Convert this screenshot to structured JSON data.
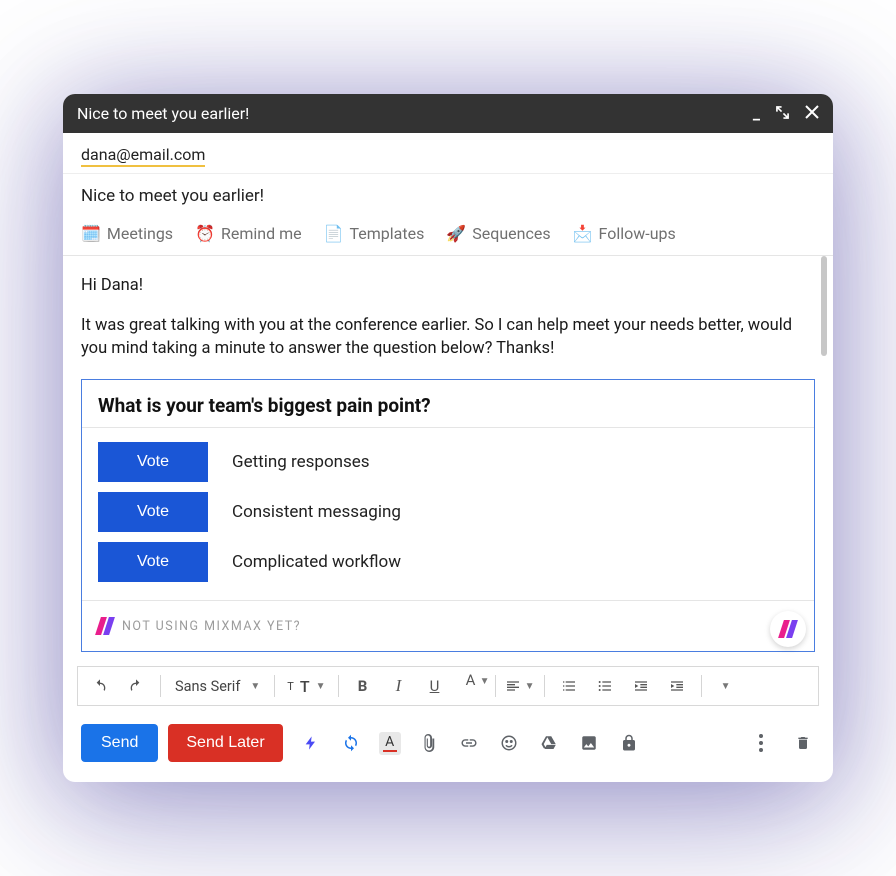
{
  "titlebar": {
    "title": "Nice to meet you earlier!"
  },
  "to": {
    "recipient": "dana@email.com"
  },
  "subject": {
    "text": "Nice to meet you earlier!"
  },
  "mm_toolbar": {
    "meetings": "Meetings",
    "remind": "Remind me",
    "templates": "Templates",
    "sequences": "Sequences",
    "followups": "Follow-ups"
  },
  "body": {
    "greeting": "Hi Dana!",
    "paragraph": "It was great talking with you at the conference earlier. So I can help meet your needs better, would you mind taking a minute to answer the question below? Thanks!"
  },
  "poll": {
    "question": "What is your team's biggest pain point?",
    "vote_label": "Vote",
    "options": {
      "o1": "Getting responses",
      "o2": "Consistent messaging",
      "o3": "Complicated workflow"
    },
    "footer_cta": "NOT USING MIXMAX YET?"
  },
  "format": {
    "font": "Sans Serif",
    "bold": "B",
    "italic": "I",
    "underline": "U",
    "text_a": "A"
  },
  "actions": {
    "send": "Send",
    "send_later": "Send Later"
  }
}
